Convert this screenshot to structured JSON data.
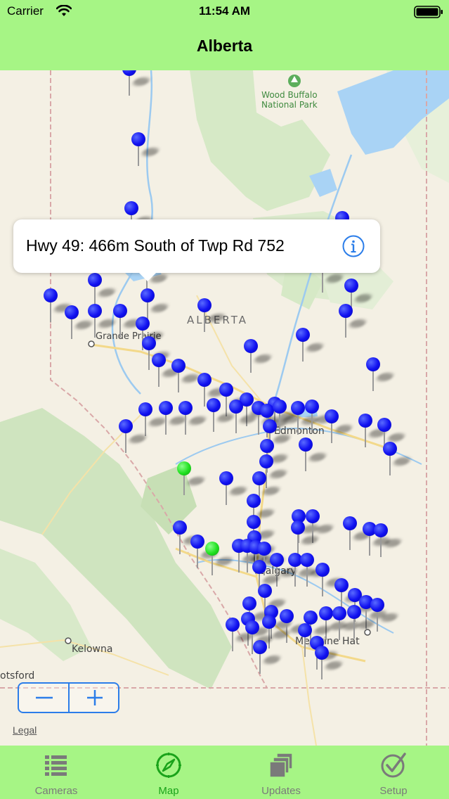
{
  "status_bar": {
    "carrier": "Carrier",
    "time": "11:54 AM"
  },
  "nav": {
    "title": "Alberta"
  },
  "map": {
    "labels": {
      "park": "Wood Buffalo\nNational Park",
      "province": "ALBERTA",
      "grande_prairie": "Grande Prairie",
      "edmonton": "Edmonton",
      "calgary": "Calgary",
      "medicine_hat": "Medicine Hat",
      "kelowna": "Kelowna",
      "abbotsford": "otsford"
    },
    "callout": {
      "text": "Hwy 49: 466m South of Twp Rd 752"
    },
    "zoom": {
      "minus": "−",
      "plus": "+"
    },
    "legal": "Legal"
  },
  "tabs": [
    {
      "label": "Cameras",
      "icon": "list-icon"
    },
    {
      "label": "Map",
      "icon": "compass-icon",
      "active": true
    },
    {
      "label": "Updates",
      "icon": "stacked-squares-icon"
    },
    {
      "label": "Setup",
      "icon": "checkmark-badge-icon"
    }
  ],
  "colors": {
    "bar_green": "#a6f585",
    "pin_blue": "#1010f0",
    "pin_green": "#20e020",
    "accent_blue": "#2b7de9"
  }
}
